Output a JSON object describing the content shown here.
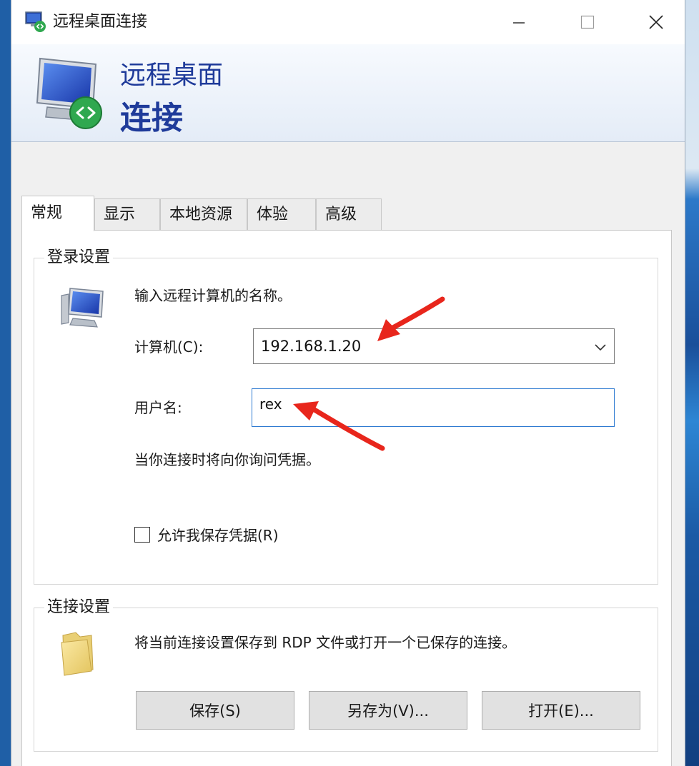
{
  "window": {
    "title": "远程桌面连接",
    "controls": {
      "minimize": "minimize",
      "maximize": "maximize",
      "close": "close"
    }
  },
  "banner": {
    "line1": "远程桌面",
    "line2": "连接"
  },
  "tabs": [
    {
      "label": "常规",
      "active": true
    },
    {
      "label": "显示",
      "active": false
    },
    {
      "label": "本地资源",
      "active": false
    },
    {
      "label": "体验",
      "active": false
    },
    {
      "label": "高级",
      "active": false
    }
  ],
  "login": {
    "group_label": "登录设置",
    "instruction": "输入远程计算机的名称。",
    "computer_label": "计算机(C):",
    "computer_value": "192.168.1.20",
    "username_label": "用户名:",
    "username_value": "rex",
    "note": "当你连接时将向你询问凭据。",
    "save_credentials_label": "允许我保存凭据(R)",
    "save_credentials_checked": false
  },
  "connection": {
    "group_label": "连接设置",
    "description": "将当前连接设置保存到 RDP 文件或打开一个已保存的连接。",
    "buttons": {
      "save": "保存(S)",
      "save_as": "另存为(V)...",
      "open": "打开(E)..."
    }
  },
  "colors": {
    "banner_title": "#1f3b9a",
    "annotation_arrow": "#e8261c",
    "input_focus": "#2e7ad1"
  },
  "icons": {
    "app": "remote-desktop-icon",
    "computer": "computer-monitor-icon",
    "folder": "folder-icon"
  }
}
